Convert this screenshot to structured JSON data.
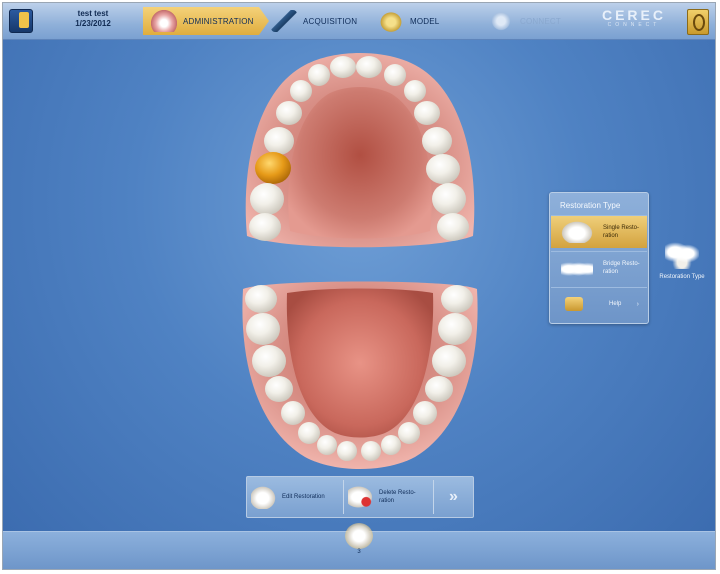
{
  "header": {
    "patient_name": "test test",
    "patient_date": "1/23/2012",
    "steps": [
      {
        "label": "ADMINISTRATION",
        "active": true
      },
      {
        "label": "ACQUISITION",
        "active": false
      },
      {
        "label": "MODEL",
        "active": false
      },
      {
        "label": "CONNECT",
        "active": false,
        "disabled": true
      }
    ],
    "brand": "CEREC",
    "brand_sub": "CONNECT"
  },
  "restoration_panel": {
    "title": "Restoration Type",
    "items": [
      {
        "label": "Single Resto-ration",
        "icon": "single-tooth-icon",
        "active": true
      },
      {
        "label": "Bridge Resto-ration",
        "icon": "bridge-icon",
        "active": false
      },
      {
        "label": "Help",
        "icon": "help-icon",
        "active": false
      }
    ]
  },
  "restoration_type_shortcut": {
    "label": "Restoration Type",
    "icon": "bridge-icon"
  },
  "toolbar": {
    "edit_label": "Edit Restoration",
    "delete_label": "Delete Resto-ration",
    "next_label": "»"
  },
  "bottom": {
    "tooth_number": "3"
  },
  "colors": {
    "background": "#4f82c3",
    "accent": "#e0ad3e",
    "selected_tooth": "#e69a18"
  }
}
